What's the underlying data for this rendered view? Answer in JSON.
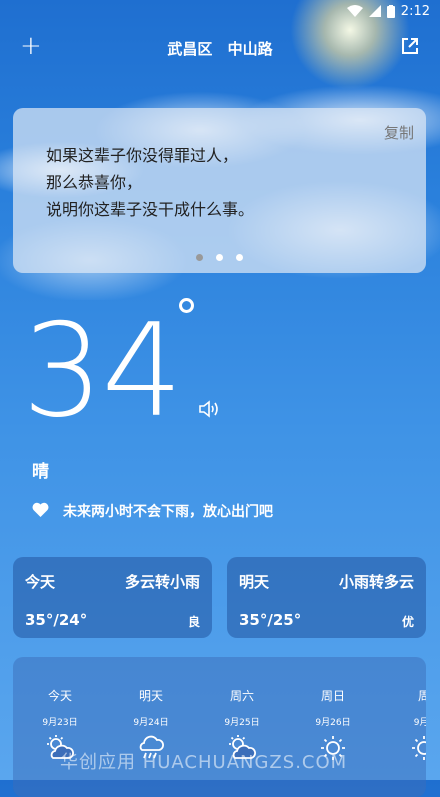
{
  "status_bar": {
    "time": "2:12"
  },
  "header": {
    "district": "武昌区",
    "street": "中山路"
  },
  "quote": {
    "copy_label": "复制",
    "lines": [
      "如果这辈子你没得罪过人，",
      "那么恭喜你，",
      "说明你这辈子没干成什么事。"
    ],
    "page_count": 3,
    "active_page": 0
  },
  "current": {
    "temperature": "34",
    "condition": "晴",
    "tip": "未来两小时不会下雨，放心出门吧"
  },
  "today_card": {
    "day": "今天",
    "condition": "多云转小雨",
    "temp_range": "35°/24°",
    "aqi": "良"
  },
  "tomorrow_card": {
    "day": "明天",
    "condition": "小雨转多云",
    "temp_range": "35°/25°",
    "aqi": "优"
  },
  "forecast": [
    {
      "day": "今天",
      "date": "9月23日",
      "icon": "partly-cloudy-icon"
    },
    {
      "day": "明天",
      "date": "9月24日",
      "icon": "rain-icon"
    },
    {
      "day": "周六",
      "date": "9月25日",
      "icon": "partly-cloudy-icon"
    },
    {
      "day": "周日",
      "date": "9月26日",
      "icon": "sun-icon"
    },
    {
      "day": "周",
      "date": "9月2",
      "icon": "sun-icon"
    }
  ],
  "watermark": "华创应用 HUACHUANGZS.COM"
}
